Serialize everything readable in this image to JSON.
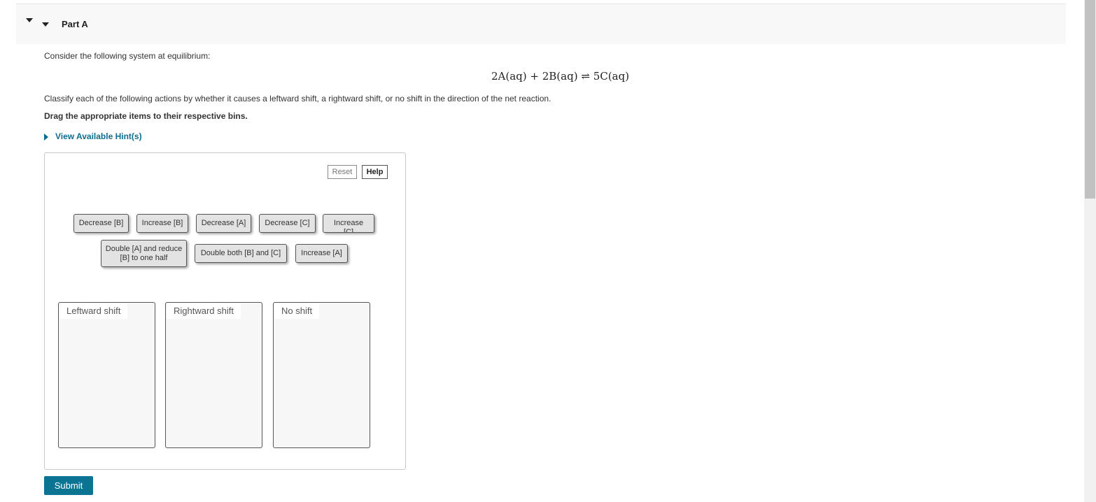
{
  "part": {
    "title": "Part A"
  },
  "question": {
    "intro": "Consider the following system at equilibrium:",
    "equation": {
      "left": "2A(aq) + 2B(aq)",
      "arrow": "⇌",
      "right": "5C(aq)"
    },
    "instruction": "Classify each of the following actions by whether it causes a leftward shift, a rightward shift, or no shift in the direction of the net reaction.",
    "drag_instruction": "Drag the appropriate items to their respective bins."
  },
  "hint": {
    "label": "View Available Hint(s)"
  },
  "toolbar": {
    "reset": "Reset",
    "help": "Help"
  },
  "items": [
    "Decrease [B]",
    "Increase [B]",
    "Decrease [A]",
    "Decrease [C]",
    "Increase [C]",
    "Double [A] and reduce [B] to one half",
    "Double both [B] and [C]",
    "Increase [A]"
  ],
  "bins": [
    "Leftward shift",
    "Rightward shift",
    "No shift"
  ],
  "submit": {
    "label": "Submit"
  },
  "colors": {
    "accent": "#0b7493",
    "link": "#0e6d8e"
  }
}
